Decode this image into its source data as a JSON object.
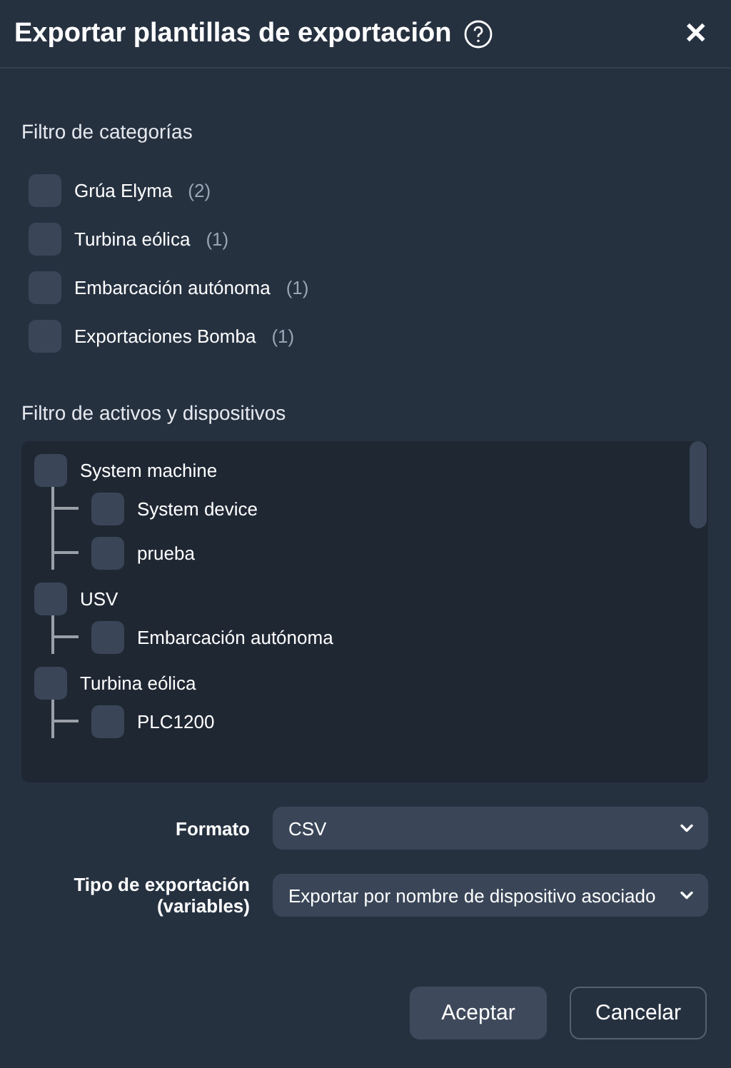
{
  "dialog": {
    "title": "Exportar plantillas de exportación",
    "close_label": "✕"
  },
  "category_filter": {
    "label": "Filtro de categorías",
    "items": [
      {
        "label": "Grúa Elyma",
        "count": "(2)",
        "checked": false
      },
      {
        "label": "Turbina eólica",
        "count": "(1)",
        "checked": false
      },
      {
        "label": "Embarcación autónoma",
        "count": "(1)",
        "checked": false
      },
      {
        "label": "Exportaciones Bomba",
        "count": "(1)",
        "checked": false
      }
    ]
  },
  "asset_filter": {
    "label": "Filtro de activos y dispositivos",
    "tree": [
      {
        "label": "System machine",
        "checked": false,
        "children": [
          {
            "label": "System device",
            "checked": false
          },
          {
            "label": "prueba",
            "checked": false
          }
        ]
      },
      {
        "label": "USV",
        "checked": false,
        "children": [
          {
            "label": "Embarcación autónoma",
            "checked": false
          }
        ]
      },
      {
        "label": "Turbina eólica",
        "checked": false,
        "children": [
          {
            "label": "PLC1200",
            "checked": false
          }
        ]
      }
    ]
  },
  "fields": [
    {
      "label": "Formato",
      "value": "CSV"
    },
    {
      "label": "Tipo de exportación (variables)",
      "value": "Exportar por nombre de dispositivo asociado"
    }
  ],
  "buttons": [
    {
      "label": "Aceptar",
      "kind": "primary"
    },
    {
      "label": "Cancelar",
      "kind": "secondary"
    }
  ]
}
